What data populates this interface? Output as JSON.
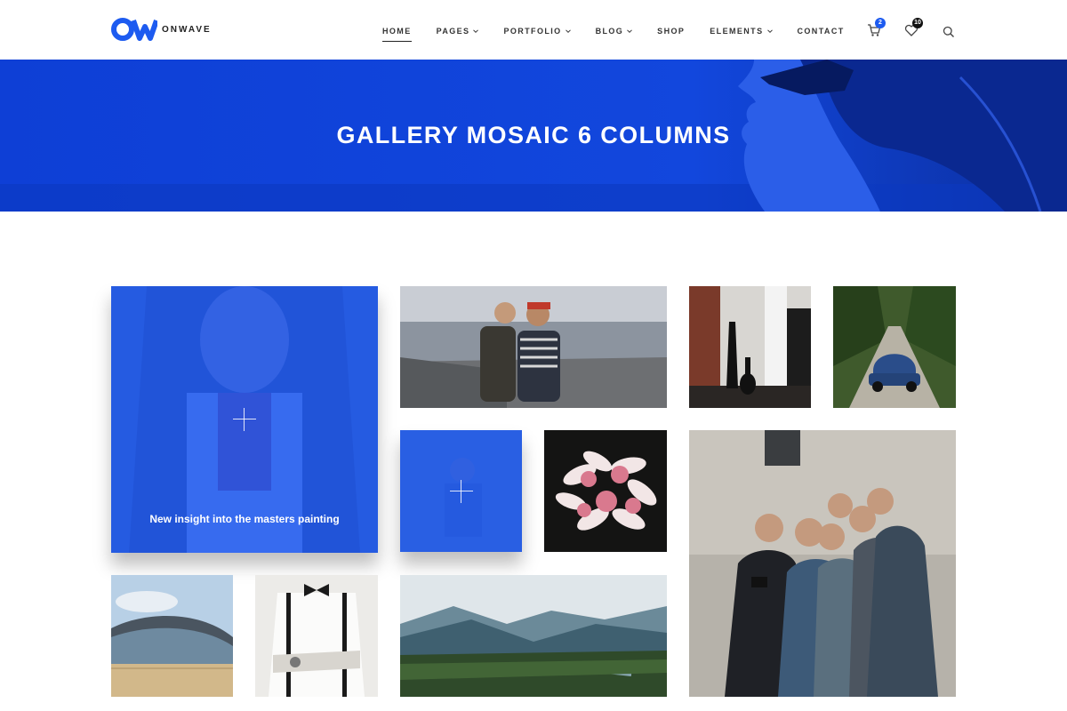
{
  "brand": {
    "mark": "OW",
    "name": "ONWAVE",
    "accent": "#1d5bf0"
  },
  "nav": {
    "items": [
      {
        "label": "HOME",
        "active": true,
        "dropdown": false
      },
      {
        "label": "PAGES",
        "active": false,
        "dropdown": true
      },
      {
        "label": "PORTFOLIO",
        "active": false,
        "dropdown": true
      },
      {
        "label": "BLOG",
        "active": false,
        "dropdown": true
      },
      {
        "label": "SHOP",
        "active": false,
        "dropdown": false
      },
      {
        "label": "ELEMENTS",
        "active": false,
        "dropdown": true
      },
      {
        "label": "CONTACT",
        "active": false,
        "dropdown": false
      }
    ]
  },
  "header_icons": {
    "cart": {
      "icon": "cart-icon",
      "count": "2"
    },
    "wishlist": {
      "icon": "heart-icon",
      "count": "10"
    },
    "search": {
      "icon": "search-icon"
    }
  },
  "hero": {
    "title": "GALLERY MOSAIC 6 COLUMNS",
    "background": "#0e3fd6"
  },
  "gallery": {
    "tiles": [
      {
        "subject": "woman holding a book",
        "caption": "New insight into the masters painting",
        "hovered": true
      },
      {
        "subject": "couple by the sea"
      },
      {
        "subject": "interior with vases"
      },
      {
        "subject": "vintage blue car on forest road"
      },
      {
        "subject": "person painting",
        "hovered": true
      },
      {
        "subject": "pink plumeria flowers"
      },
      {
        "subject": "group of friends taking selfie"
      },
      {
        "subject": "modern stadium building"
      },
      {
        "subject": "man with bow tie and suspenders"
      },
      {
        "subject": "mountain landscape"
      }
    ]
  }
}
